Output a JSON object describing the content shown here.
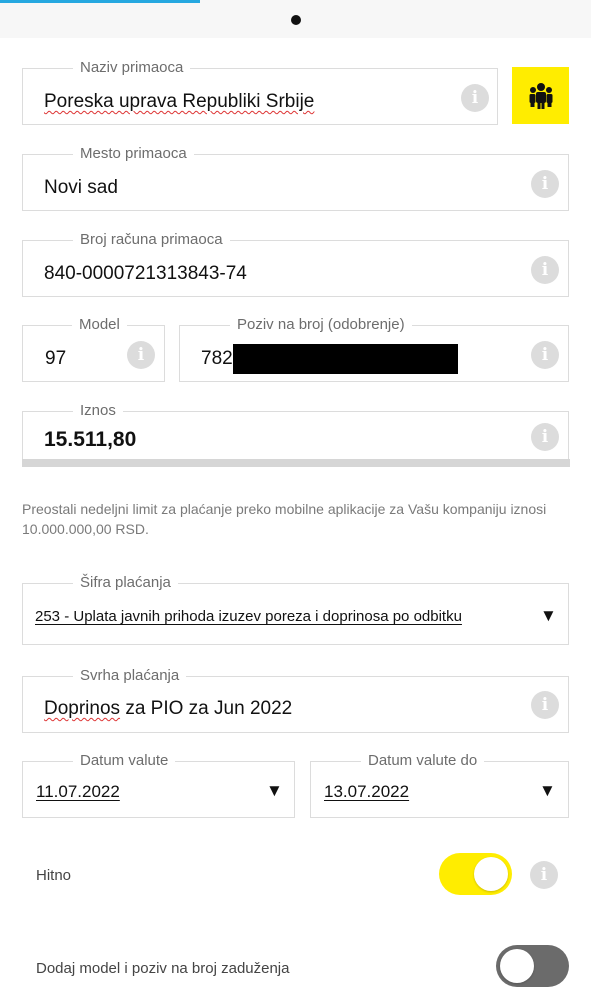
{
  "recipient_name": {
    "label": "Naziv primaoca",
    "value": "Poreska uprava Republiki Srbije"
  },
  "recipient_city": {
    "label": "Mesto primaoca",
    "value": "Novi sad"
  },
  "recipient_account": {
    "label": "Broj računa primaoca",
    "value": "840-0000721313843-74"
  },
  "model": {
    "label": "Model",
    "value": "97"
  },
  "reference": {
    "label": "Poziv na broj (odobrenje)",
    "value": "782"
  },
  "amount": {
    "label": "Iznos",
    "value": "15.511,80"
  },
  "limit_note": "Preostali nedeljni limit za plaćanje preko mobilne aplikacije za Vašu kompaniju iznosi 10.000.000,00 RSD.",
  "payment_code": {
    "label": "Šifra plaćanja",
    "value": "253 - Uplata javnih prihoda izuzev  poreza i doprinosa po odbitku"
  },
  "purpose": {
    "label": "Svrha plaćanja",
    "value_word1": "Doprinos",
    "value_rest": " za PIO za Jun 2022"
  },
  "value_date": {
    "label": "Datum valute",
    "value": "11.07.2022"
  },
  "value_date_to": {
    "label": "Datum valute do",
    "value": "13.07.2022"
  },
  "urgent": {
    "label": "Hitno",
    "enabled": true
  },
  "debit_reference": {
    "label": "Dodaj model i poziv na broj zaduženja",
    "enabled": false
  },
  "colors": {
    "accent": "#ffed00",
    "toggle_on": "#ffed00",
    "toggle_off": "#6b6b6b"
  },
  "icons": {
    "info": "info-icon",
    "contacts": "contacts-icon",
    "dropdown": "dropdown-arrow-icon"
  },
  "glyphs": {
    "info": "i",
    "caret": "▼"
  }
}
